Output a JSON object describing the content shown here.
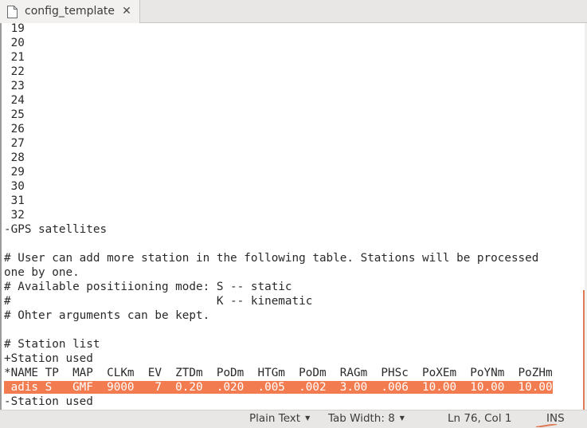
{
  "tab": {
    "title": "config_template",
    "close_glyph": "✕",
    "icon": "text-document-icon"
  },
  "editor": {
    "lines": [
      " 19",
      " 20",
      " 21",
      " 22",
      " 23",
      " 24",
      " 25",
      " 26",
      " 27",
      " 28",
      " 29",
      " 30",
      " 31",
      " 32",
      "-GPS satellites",
      "",
      "# User can add more station in the following table. Stations will be processed",
      "one by one.",
      "# Available positiioning mode: S -- static",
      "#                              K -- kinematic",
      "# Ohter arguments can be kept.",
      "",
      "# Station list",
      "+Station used",
      "*NAME TP  MAP  CLKm  EV  ZTDm  PoDm  HTGm  PoDm  RAGm  PHSc  PoXEm  PoYNm  PoZHm",
      " adis S   GMF  9000   7  0.20  .020  .005  .002  3.00  .006  10.00  10.00  10.00",
      "-Station used"
    ],
    "highlighted_line_index": 25,
    "selection_color": "#f27c4f"
  },
  "statusbar": {
    "syntax": "Plain Text",
    "tab_width": "Tab Width: 8",
    "position": "Ln 76, Col 1",
    "mode": "INS"
  }
}
